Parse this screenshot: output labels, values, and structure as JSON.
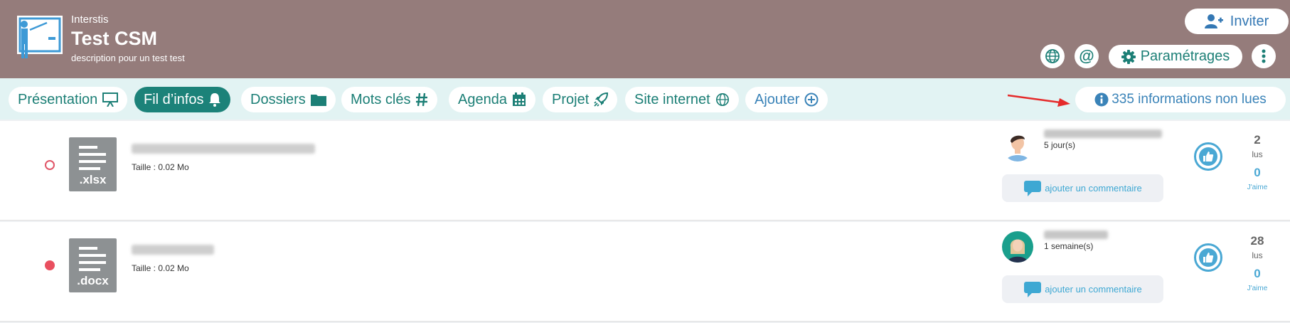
{
  "header": {
    "org": "Interstis",
    "title": "Test CSM",
    "description": "description pour un test test",
    "invite_label": "Inviter",
    "settings_label": "Paramétrages",
    "at_symbol": "@"
  },
  "tabs": [
    {
      "label": "Présentation",
      "icon": "presentation-icon"
    },
    {
      "label": "Fil d’infos",
      "icon": "bell-icon",
      "active": true
    },
    {
      "label": "Dossiers",
      "icon": "folder-icon"
    },
    {
      "label": "Mots clés",
      "icon": "hashtag-icon"
    },
    {
      "label": "Agenda",
      "icon": "calendar-icon"
    },
    {
      "label": "Projet",
      "icon": "rocket-icon"
    },
    {
      "label": "Site internet",
      "icon": "globe-icon"
    },
    {
      "label": "Ajouter",
      "icon": "plus-circle-icon"
    }
  ],
  "unread": {
    "label": "335 informations non lues"
  },
  "rows": [
    {
      "extension": ".xlsx",
      "size": "Taille : 0.02 Mo",
      "ago": "5 jour(s)",
      "comment_label": "ajouter un commentaire",
      "reads": "2",
      "reads_label": "lus",
      "likes": "0",
      "likes_label": "J'aime",
      "status": "unread"
    },
    {
      "extension": ".docx",
      "size": "Taille : 0.02 Mo",
      "ago": "1 semaine(s)",
      "comment_label": "ajouter un commentaire",
      "reads": "28",
      "reads_label": "lus",
      "likes": "0",
      "likes_label": "J'aime",
      "status": "read"
    }
  ],
  "colors": {
    "header_bg": "#957c7b",
    "tabbar_bg": "#e2f3f3",
    "accent_teal": "#1c8279",
    "accent_blue": "#3a83b8",
    "status_red": "#e94f5f"
  }
}
